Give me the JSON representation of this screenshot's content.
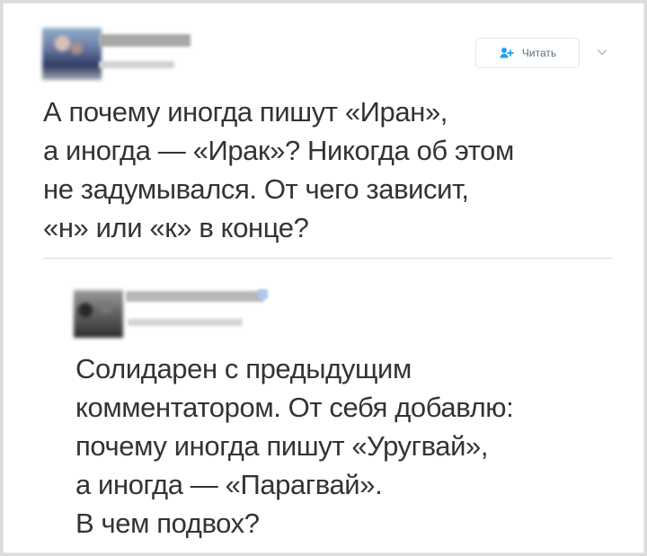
{
  "tweet_1": {
    "follow_label": "Читать",
    "follow_icon": "add-user-icon",
    "menu_icon": "chevron-down-icon",
    "lines": [
      "А почему иногда пишут «Иран»,",
      "а иногда — «Ирак»? Никогда об этом",
      "не задумывался. От чего зависит,",
      "«н» или «к» в конце?"
    ]
  },
  "tweet_2": {
    "lines": [
      "Солидарен с предыдущим",
      "комментатором. От себя добавлю:",
      "почему иногда пишут «Уругвай»,",
      "а иногда — «Парагвай».",
      "В чем подвох?"
    ]
  },
  "colors": {
    "text": "#333333",
    "button_text": "#5b6f80",
    "button_border": "#e0e5ea",
    "divider": "#dddddd",
    "accent": "#1da1f2"
  }
}
